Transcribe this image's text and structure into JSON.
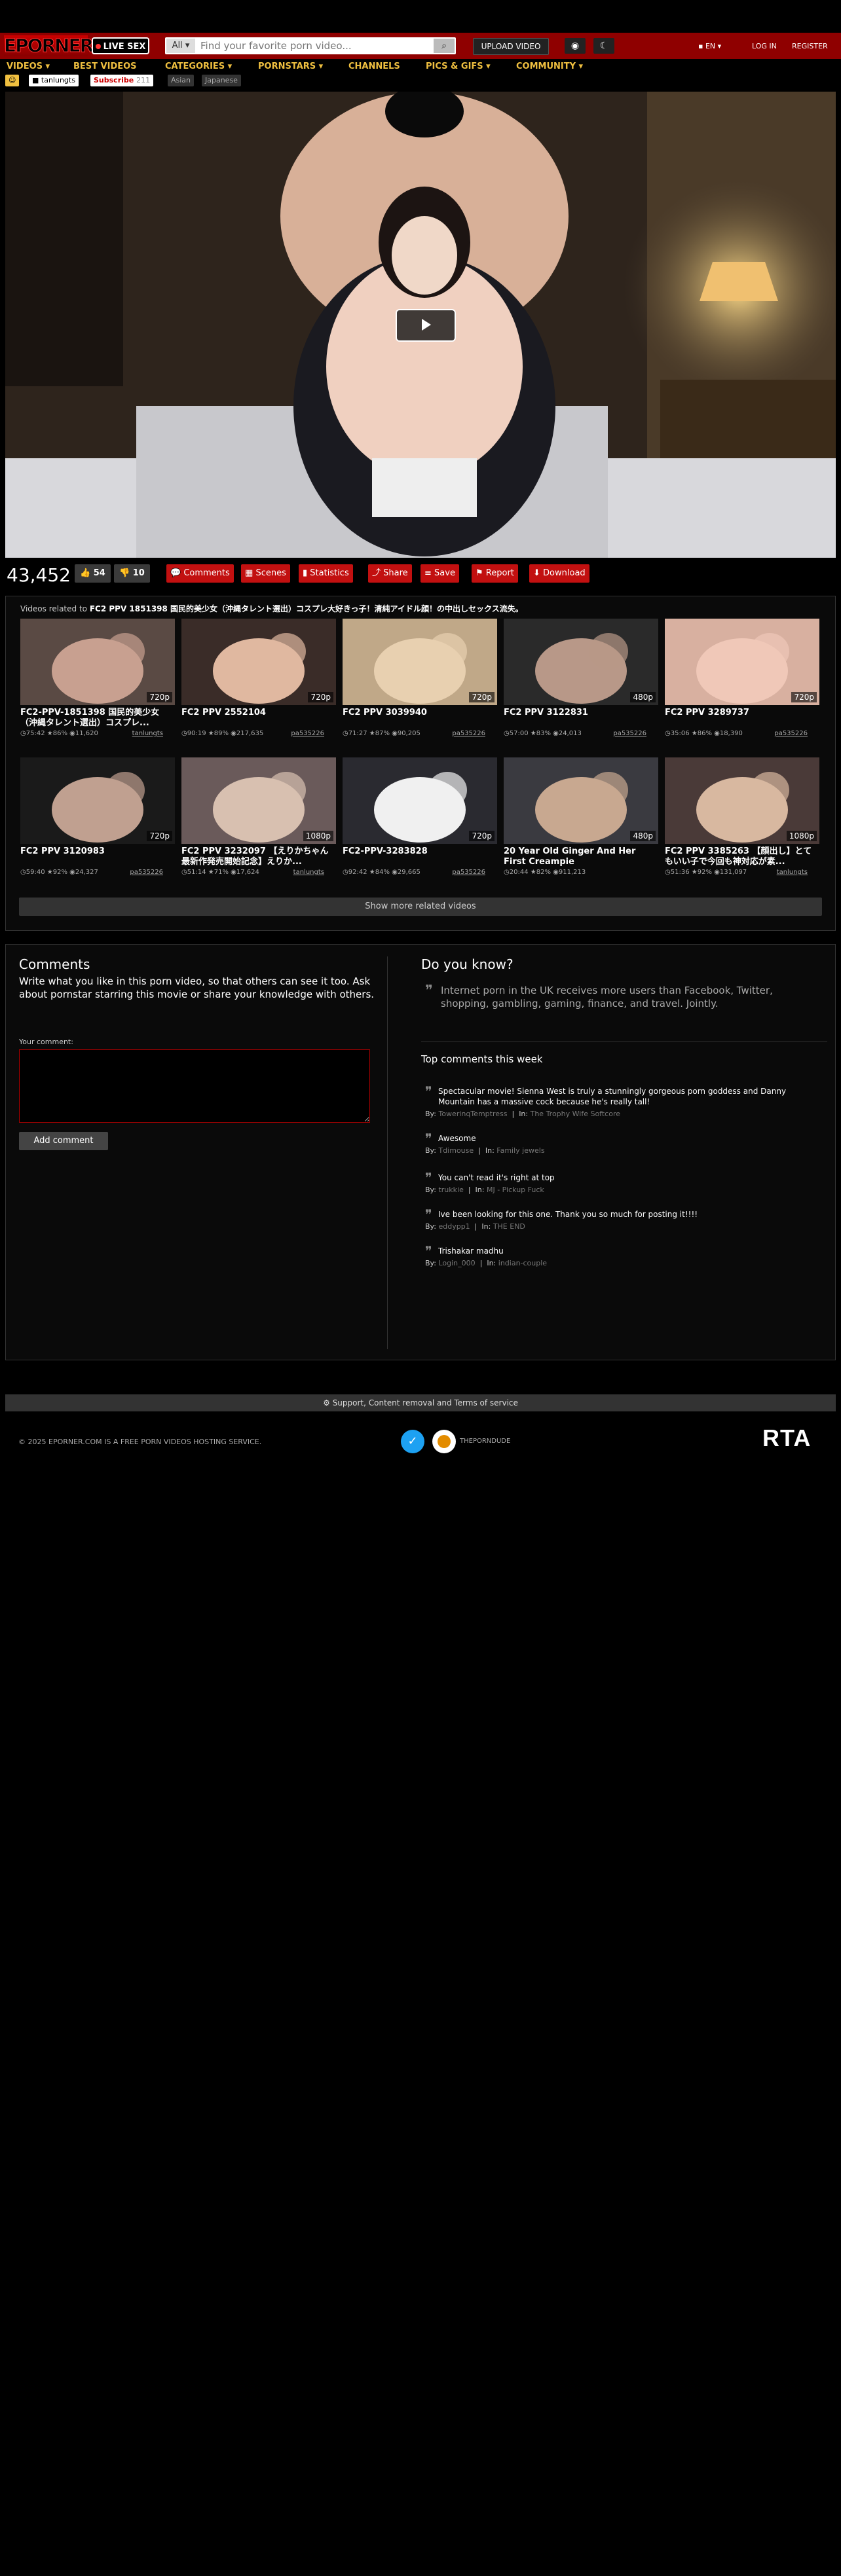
{
  "header": {
    "logo": "EPORNER",
    "live_sex": "LIVE SEX",
    "search_category": "All",
    "search_placeholder": "Find your favorite porn video...",
    "upload_label": "UPLOAD VIDEO",
    "lang": "EN",
    "login": "LOG IN",
    "register": "REGISTER"
  },
  "nav": [
    {
      "label": "VIDEOS"
    },
    {
      "label": "BEST VIDEOS"
    },
    {
      "label": "CATEGORIES"
    },
    {
      "label": "PORNSTARS"
    },
    {
      "label": "CHANNELS"
    },
    {
      "label": "PICS & GIFS"
    },
    {
      "label": "COMMUNITY"
    }
  ],
  "tags": {
    "uploader": "tanlungts",
    "subscribe": "Subscribe",
    "subscribe_count": "211",
    "tag1": "Asian",
    "tag2": "Japanese"
  },
  "video": {
    "views": "43,452",
    "likes": "54",
    "dislikes": "10",
    "actions": [
      "Comments",
      "Scenes",
      "Statistics",
      "Share",
      "Save",
      "Report",
      "Download"
    ]
  },
  "related": {
    "label": "Videos related to",
    "title": "FC2 PPV 1851398 国民的美少女（沖縄タレント選出）コスプレ大好きっ子！清純アイドル顔！の中出しセックス流失。",
    "more_label": "Show more related videos",
    "items": [
      {
        "title": "FC2-PPV-1851398 国民的美少女（沖縄タレント選出）コスプレ...",
        "quality": "720p",
        "duration": "75:42",
        "rating": "86%",
        "views": "11,620",
        "uploader": "tanlungts"
      },
      {
        "title": "FC2 PPV 2552104",
        "quality": "720p",
        "duration": "90:19",
        "rating": "89%",
        "views": "217,635",
        "uploader": "pa535226"
      },
      {
        "title": "FC2 PPV 3039940",
        "quality": "720p",
        "duration": "71:27",
        "rating": "87%",
        "views": "90,205",
        "uploader": "pa535226"
      },
      {
        "title": "FC2 PPV 3122831",
        "quality": "480p",
        "duration": "57:00",
        "rating": "83%",
        "views": "24,013",
        "uploader": "pa535226"
      },
      {
        "title": "FC2 PPV 3289737",
        "quality": "720p",
        "duration": "35:06",
        "rating": "86%",
        "views": "18,390",
        "uploader": "pa535226"
      },
      {
        "title": "FC2 PPV 3120983",
        "quality": "720p",
        "duration": "59:40",
        "rating": "92%",
        "views": "24,327",
        "uploader": "pa535226"
      },
      {
        "title": "FC2 PPV 3232097 【えりかちゃん最新作発売開始記念】えりか...",
        "quality": "1080p",
        "duration": "51:14",
        "rating": "71%",
        "views": "17,624",
        "uploader": "tanlungts"
      },
      {
        "title": "FC2-PPV-3283828",
        "quality": "720p",
        "duration": "92:42",
        "rating": "84%",
        "views": "29,665",
        "uploader": "pa535226"
      },
      {
        "title": "20 Year Old Ginger And Her First Creampie",
        "quality": "480p",
        "duration": "20:44",
        "rating": "82%",
        "views": "911,213",
        "uploader": ""
      },
      {
        "title": "FC2 PPV 3385263 【顔出し】とてもいい子で今回も神対応が素...",
        "quality": "1080p",
        "duration": "51:36",
        "rating": "92%",
        "views": "131,097",
        "uploader": "tanlungts"
      }
    ]
  },
  "comments": {
    "title": "Comments",
    "desc": "Write what you like in this porn video, so that others can see it too. Ask about pornstar starring this movie or share your knowledge with others.",
    "label": "Your comment:",
    "button": "Add comment"
  },
  "dyk": {
    "title": "Do you know?",
    "text": "Internet porn in the UK receives more users than Facebook, Twitter, shopping, gambling, gaming, finance, and travel. Jointly."
  },
  "top_comments": {
    "title": "Top comments this week",
    "by_label": "By:",
    "in_label": "In:",
    "items": [
      {
        "text": "Spectacular movie! Sienna West is truly a stunningly gorgeous porn goddess and Danny Mountain has a massive cock because he's really tall!",
        "by": "TowerinqTemptress",
        "in": "The Trophy Wife Softcore"
      },
      {
        "text": "Awesome",
        "by": "Tdimouse",
        "in": "Family jewels"
      },
      {
        "text": "You can't read it's right at top",
        "by": "trukkie",
        "in": "MJ - Pickup Fuck"
      },
      {
        "text": "Ive been looking for this one. Thank you so much for posting it!!!!",
        "by": "eddypp1",
        "in": "THE END"
      },
      {
        "text": "Trishakar madhu",
        "by": "Login_000",
        "in": "indian-couple"
      }
    ]
  },
  "footer": {
    "support": "Support, Content removal and Terms of service",
    "copy": "© 2025 EPORNER.COM IS A FREE PORN VIDEOS HOSTING SERVICE.",
    "theporndude": "THEPORNDUDE",
    "rta": "RTA"
  }
}
